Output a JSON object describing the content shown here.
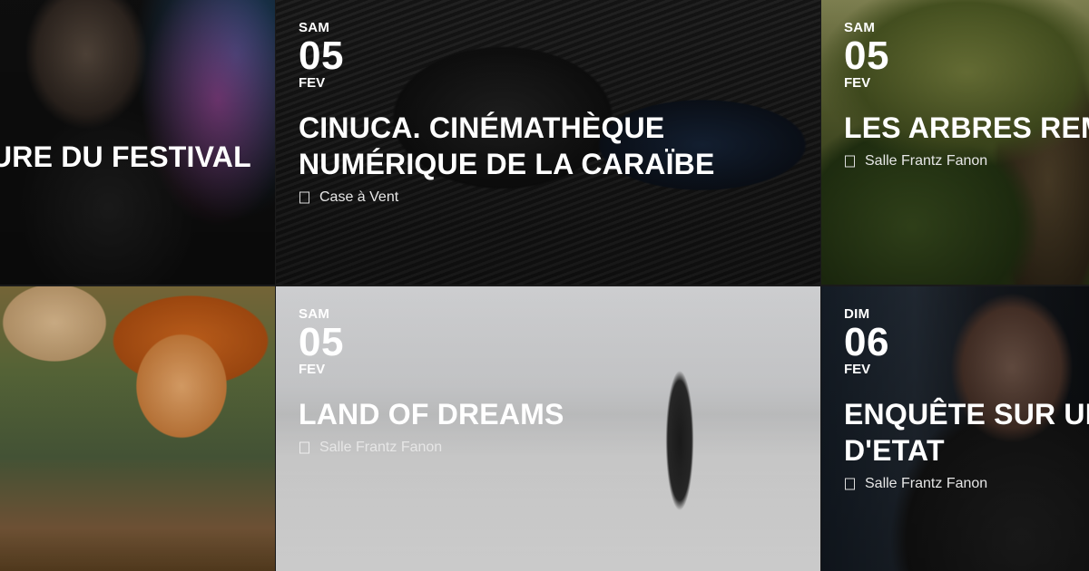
{
  "events": [
    {
      "day": "",
      "date": "",
      "month": "",
      "title": "URE DU FESTIVAL",
      "venue": ""
    },
    {
      "day": "SAM",
      "date": "05",
      "month": "FEV",
      "title": "CINUCA. CINÉMATHÈQUE NUMÉRIQUE DE LA CARAÏBE",
      "venue": "Case à Vent"
    },
    {
      "day": "SAM",
      "date": "05",
      "month": "FEV",
      "title": "LES ARBRES REM",
      "venue": "Salle Frantz Fanon"
    },
    {
      "day": "",
      "date": "",
      "month": "",
      "title": "",
      "venue": ""
    },
    {
      "day": "SAM",
      "date": "05",
      "month": "FEV",
      "title": "LAND OF DREAMS",
      "venue": "Salle Frantz Fanon"
    },
    {
      "day": "DIM",
      "date": "06",
      "month": "FEV",
      "title": "ENQUÊTE SUR UI D'ETAT",
      "venue": "Salle Frantz Fanon"
    }
  ],
  "icons": {
    "venue": "map-marker-icon"
  }
}
